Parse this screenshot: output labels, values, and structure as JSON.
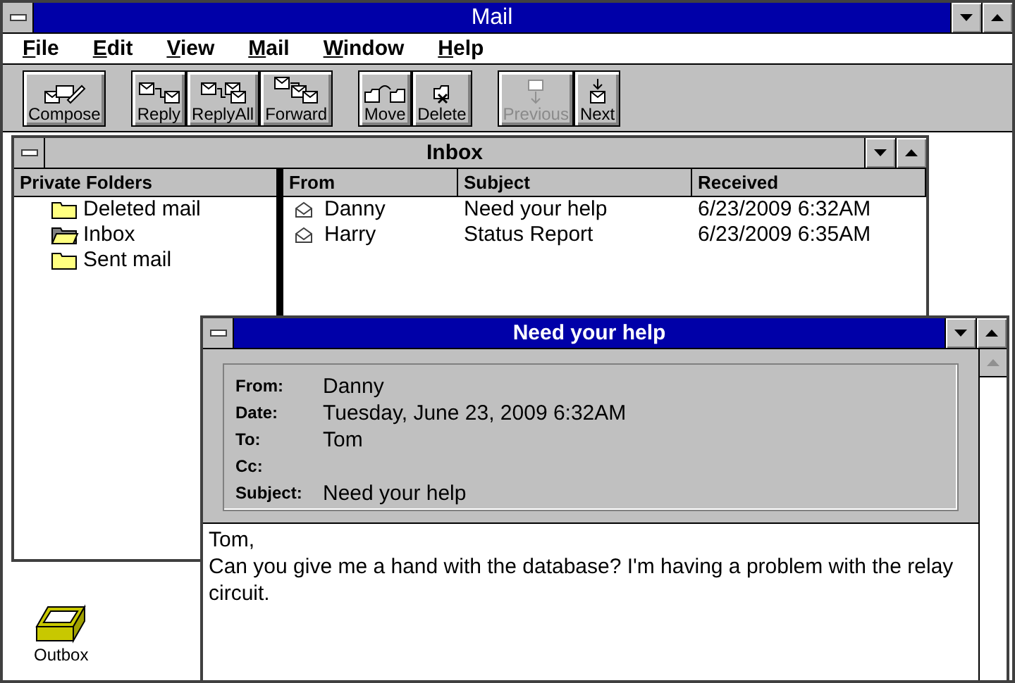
{
  "window": {
    "title": "Mail"
  },
  "menu": [
    "File",
    "Edit",
    "View",
    "Mail",
    "Window",
    "Help"
  ],
  "toolbar": [
    [
      {
        "label": "Compose",
        "kind": "compose",
        "disabled": false
      }
    ],
    [
      {
        "label": "Reply",
        "kind": "reply",
        "disabled": false
      },
      {
        "label": "ReplyAll",
        "kind": "replyall",
        "disabled": false
      },
      {
        "label": "Forward",
        "kind": "forward",
        "disabled": false
      }
    ],
    [
      {
        "label": "Move",
        "kind": "move",
        "disabled": false
      },
      {
        "label": "Delete",
        "kind": "delete",
        "disabled": false
      }
    ],
    [
      {
        "label": "Previous",
        "kind": "previous",
        "disabled": true
      },
      {
        "label": "Next",
        "kind": "next",
        "disabled": false
      }
    ]
  ],
  "inbox": {
    "title": "Inbox",
    "folders_heading": "Private Folders",
    "folders": [
      {
        "label": "Deleted mail",
        "open": false
      },
      {
        "label": "Inbox",
        "open": true
      },
      {
        "label": "Sent mail",
        "open": false
      }
    ],
    "columns": [
      "From",
      "Subject",
      "Received"
    ],
    "rows": [
      {
        "from": "Danny",
        "subject": "Need your help",
        "received": "6/23/2009 6:32AM"
      },
      {
        "from": "Harry",
        "subject": "Status Report",
        "received": "6/23/2009 6:35AM"
      }
    ]
  },
  "message": {
    "title": "Need your help",
    "fields": [
      {
        "label": "From:",
        "value": "Danny"
      },
      {
        "label": "Date:",
        "value": "Tuesday, June 23, 2009 6:32AM"
      },
      {
        "label": "To:",
        "value": "Tom"
      },
      {
        "label": "Cc:"
      },
      {
        "label": "Subject:",
        "value": "Need your help"
      }
    ],
    "body": [
      "Tom,",
      "Can you give me a hand with the database? I'm having a problem with the relay circuit."
    ]
  },
  "desktop_icons": [
    {
      "label": "Outbox"
    }
  ]
}
